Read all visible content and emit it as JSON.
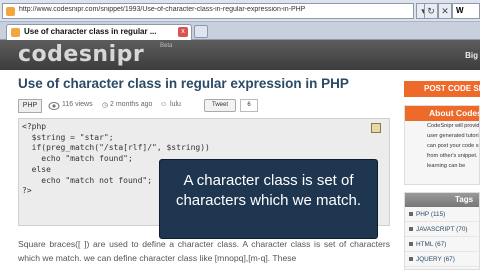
{
  "browser": {
    "url": "http://www.codesnipr.com/snippet/1993/Use-of-character-class-in-regular-expression-in-PHP",
    "tab_title": "Use of character class in regular ...",
    "tab_close": "x",
    "back_glyph": "◀",
    "refresh_glyph": "↻",
    "close_glyph": "✕",
    "search_engine": "W"
  },
  "header": {
    "logo": "codesnipr",
    "beta": "Beta",
    "right_link": "Big"
  },
  "snippet": {
    "title": "Use of character class in regular expression in PHP",
    "language": "PHP",
    "views": "116 views",
    "time": "2 months ago",
    "author": "lulu",
    "tweet_label": "Tweet",
    "tweet_count": "6",
    "code_lines": [
      "<?php",
      "  $string = \"star\";",
      "  if(preg_match(\"/sta[rlf]/\", $string))",
      "    echo \"match found\";",
      "  else",
      "    echo \"match not found\";",
      "?>"
    ],
    "description": "Square braces([ ]) are used to define a character class. A character class is set of characters which we match. we can define character class like [mnopq],[m-q]. These"
  },
  "sidebar": {
    "post_button": "POST CODE SN",
    "about_title": "About Codes",
    "about_lines": [
      "CodeSnipr will provide you",
      "user generated tutorial",
      "can post your code snip",
      "from other's snippet.",
      "learning can be"
    ],
    "tags_title": "Tags",
    "tags": [
      {
        "name": "PHP",
        "count": "(115)"
      },
      {
        "name": "JAVASCRIPT",
        "count": "(70)"
      },
      {
        "name": "HTML",
        "count": "(67)"
      },
      {
        "name": "JQUERY",
        "count": "(67)"
      }
    ]
  },
  "caption": {
    "text": "A character class is set of characters which we match."
  }
}
